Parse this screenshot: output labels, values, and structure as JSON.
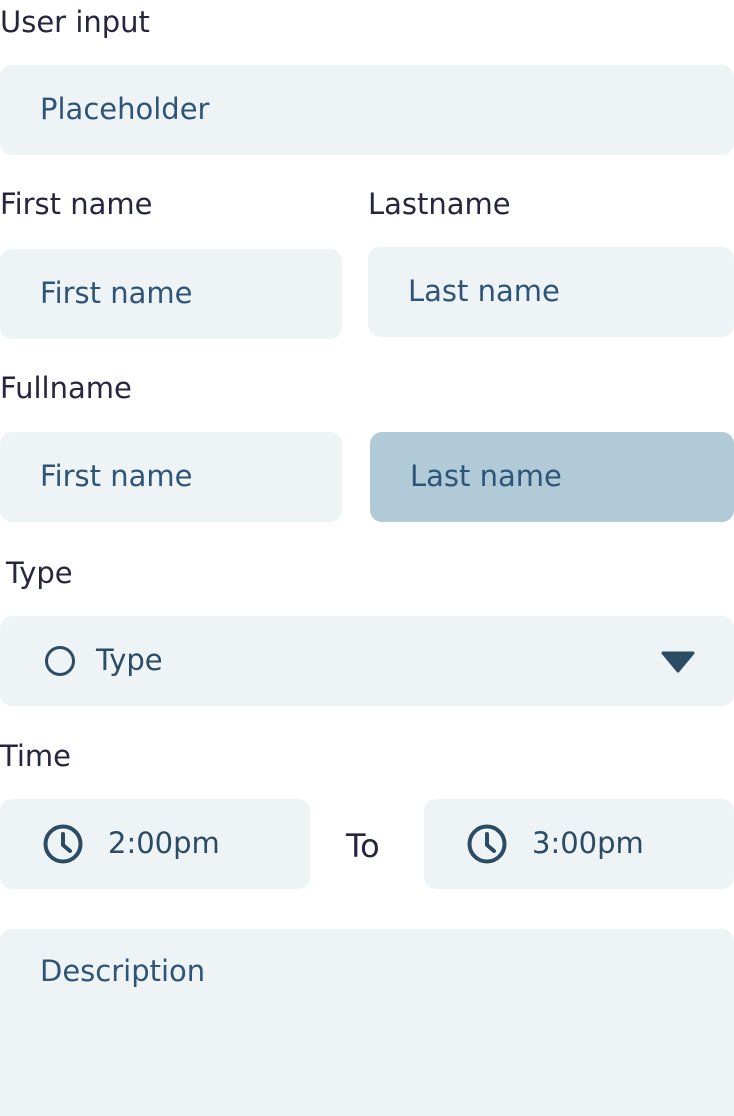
{
  "user_input": {
    "label": "User input",
    "placeholder": "Placeholder"
  },
  "name": {
    "first_label": "First name",
    "last_label": "Lastname",
    "first_placeholder": "First name",
    "last_placeholder": "Last name"
  },
  "fullname": {
    "label": "Fullname",
    "first_placeholder": "First name",
    "last_placeholder": "Last name"
  },
  "type": {
    "label": "Type",
    "value": "Type"
  },
  "time": {
    "label": "Time",
    "from": "2:00pm",
    "separator": "To",
    "to": "3:00pm"
  },
  "description": {
    "placeholder": "Description"
  },
  "colors": {
    "field_bg": "#eef3f6",
    "field_active_bg": "#b0cad7",
    "placeholder_text": "#2e5578",
    "label_text": "#262641",
    "icon": "#2c4b64"
  },
  "icons": {
    "type_radio": "circle-outline-icon",
    "type_dropdown": "caret-down-icon",
    "time_from": "clock-icon",
    "time_to": "clock-icon"
  }
}
